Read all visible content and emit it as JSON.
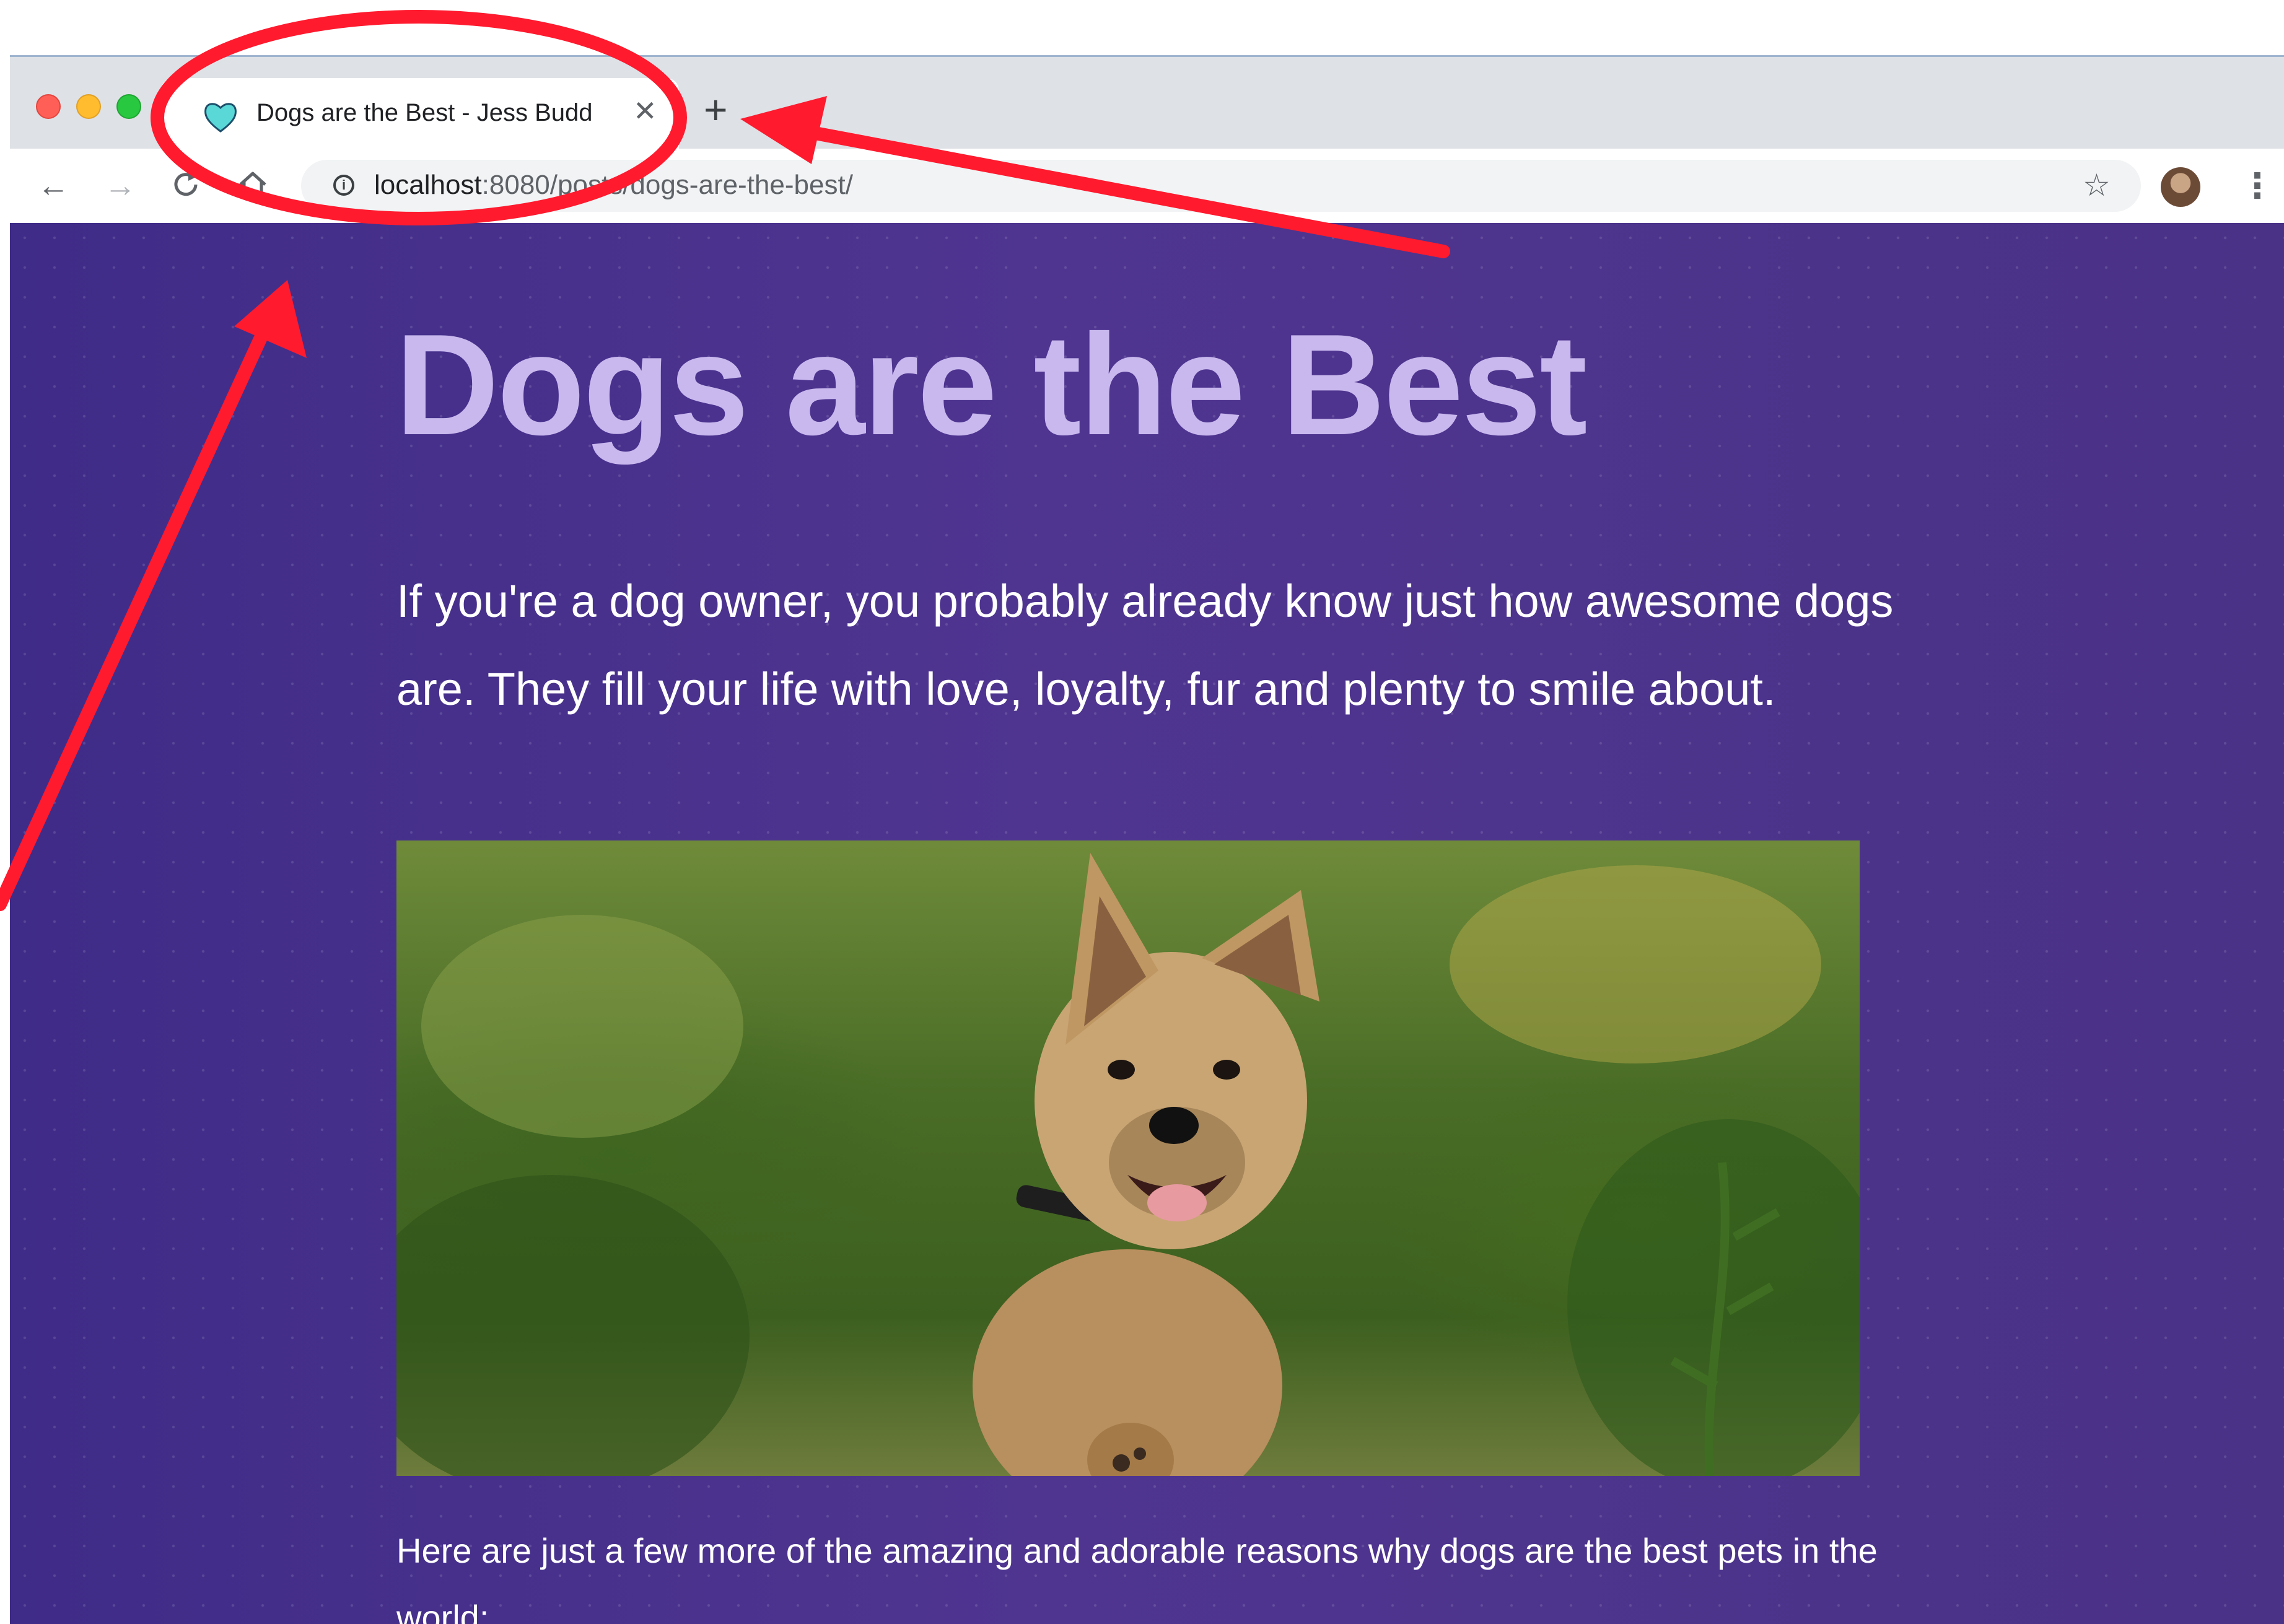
{
  "browser": {
    "tab": {
      "title": "Dogs are the Best - Jess Budd",
      "favicon_icon": "heart-icon",
      "favicon_color": "#5ad8d8"
    },
    "address": {
      "host": "localhost",
      "rest": ":8080/posts/dogs-are-the-best/"
    },
    "icons": {
      "back": "arrow-left-icon",
      "forward": "arrow-right-icon",
      "reload": "reload-icon",
      "home": "home-icon",
      "site_info": "info-icon",
      "bookmark": "star-icon",
      "menu": "kebab-menu-icon",
      "new_tab": "plus-icon",
      "close_tab": "close-icon"
    }
  },
  "page": {
    "title": "Dogs are the Best",
    "intro": "If you're a dog owner, you probably already know just how awesome dogs are. They fill your life with love, loyalty, fur and plenty to smile about.",
    "hero_image": "photo of a scruffy terrier puppy running through green grass",
    "after_image": "Here are just a few more of the amazing and adorable reasons why dogs are the best pets in the world:"
  },
  "colors": {
    "page_background": "#4a3288",
    "title": "#c8b8ee",
    "annotation": "#ff1a2e"
  }
}
